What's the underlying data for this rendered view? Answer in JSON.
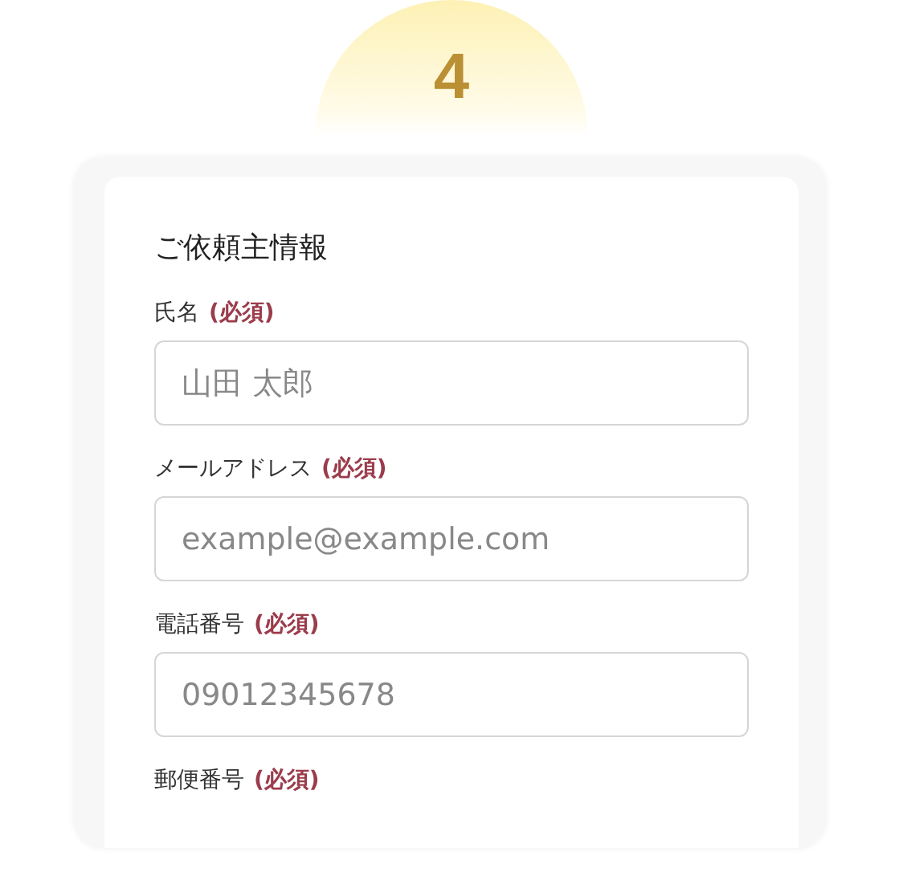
{
  "step": {
    "number": "4"
  },
  "section": {
    "title": "ご依頼主情報"
  },
  "fields": [
    {
      "label": "氏名",
      "required": "(必須)",
      "placeholder": "山田 太郎"
    },
    {
      "label": "メールアドレス",
      "required": "(必須)",
      "placeholder": "example@example.com"
    },
    {
      "label": "電話番号",
      "required": "(必須)",
      "placeholder": "09012345678"
    },
    {
      "label": "郵便番号",
      "required": "(必須)"
    }
  ]
}
